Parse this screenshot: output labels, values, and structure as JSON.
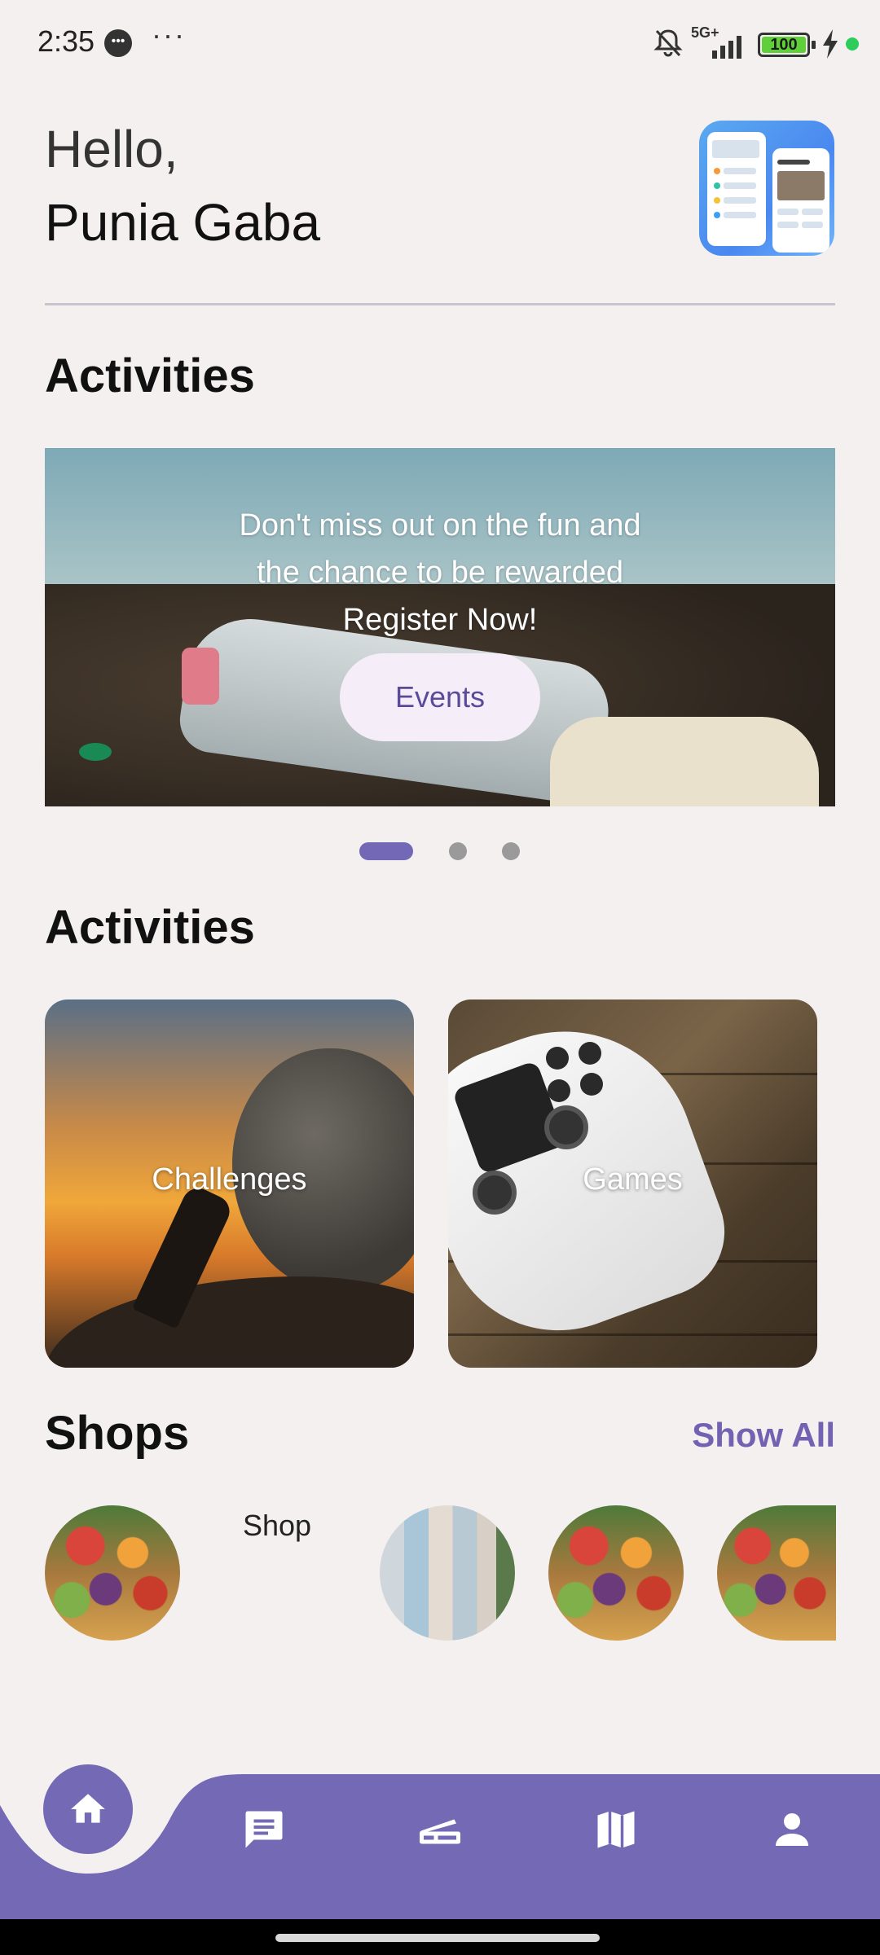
{
  "status_bar": {
    "time": "2:35",
    "chat_icon": "chat-bubble-icon",
    "more": "···",
    "network": "5G+",
    "battery": "100",
    "bell_icon": "bell-off-icon"
  },
  "greeting": {
    "hello": "Hello,",
    "name": "Punia Gaba"
  },
  "activities_banner": {
    "title": "Activities",
    "line1": "Don't miss out on the fun and",
    "line2": "the chance to be rewarded",
    "line3": "Register Now!",
    "button": "Events",
    "carousel_pages": 3,
    "active_page": 1
  },
  "activities_cards": {
    "title": "Activities",
    "cards": [
      {
        "label": "Challenges"
      },
      {
        "label": "Games"
      }
    ]
  },
  "shops": {
    "title": "Shops",
    "show_all": "Show All",
    "shop_label": "Shop"
  },
  "bottom_nav": {
    "accent_color": "#7369b4",
    "items": [
      "home-icon",
      "chat-icon",
      "scanner-icon",
      "map-icon",
      "profile-icon"
    ]
  }
}
